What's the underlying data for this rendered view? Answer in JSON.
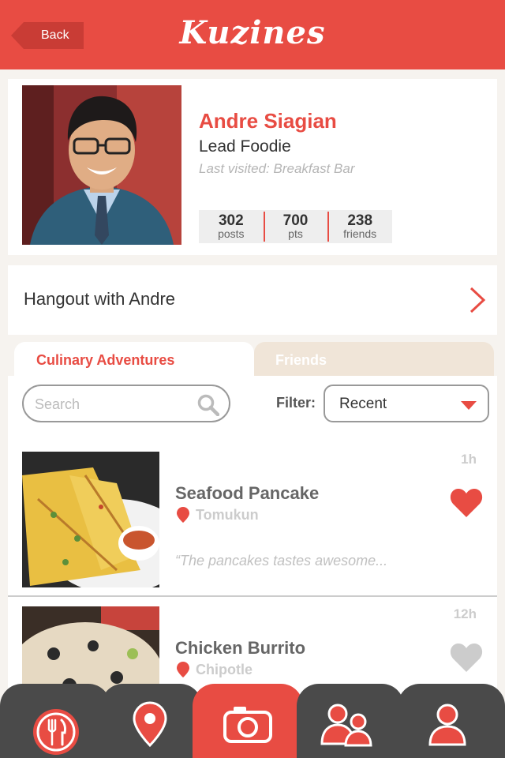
{
  "header": {
    "back_label": "Back",
    "brand": "Kuzines"
  },
  "profile": {
    "name": "Andre Siagian",
    "role": "Lead Foodie",
    "last_visited": "Last visited: Breakfast Bar",
    "stats": [
      {
        "value": "302",
        "label": "posts"
      },
      {
        "value": "700",
        "label": "pts"
      },
      {
        "value": "238",
        "label": "friends"
      }
    ]
  },
  "hangout": {
    "label": "Hangout with Andre"
  },
  "tabs": [
    {
      "label": "Culinary Adventures",
      "active": true
    },
    {
      "label": "Friends",
      "active": false
    }
  ],
  "search": {
    "placeholder": "Search",
    "value": ""
  },
  "filter": {
    "label": "Filter:",
    "selected": "Recent"
  },
  "posts": [
    {
      "time": "1h",
      "title": "Seafood Pancake",
      "location": "Tomukun",
      "quote": "“The pancakes tastes awesome...",
      "liked": true
    },
    {
      "time": "12h",
      "title": "Chicken Burrito",
      "location": "Chipotle",
      "quote": "",
      "liked": false
    }
  ],
  "nav": {
    "items": [
      {
        "icon": "fork-knife-icon",
        "active": false
      },
      {
        "icon": "map-pin-icon",
        "active": false
      },
      {
        "icon": "camera-icon",
        "active": true
      },
      {
        "icon": "friends-icon",
        "active": false
      },
      {
        "icon": "user-icon",
        "active": false
      }
    ]
  },
  "colors": {
    "accent": "#e84c43",
    "nav_dark": "#4a4a4a",
    "heart_inactive": "#cccccc",
    "tab_inactive": "#f0e5d8"
  }
}
